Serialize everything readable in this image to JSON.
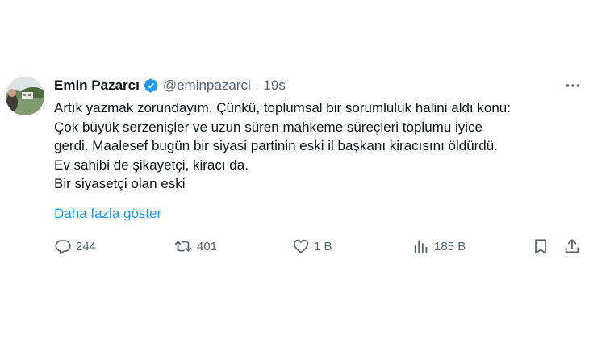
{
  "tweet": {
    "author": {
      "name": "Emin Pazarcı",
      "handle": "@eminpazarci",
      "separator": "·",
      "time": "19s",
      "verified": true
    },
    "lines": [
      "Artık yazmak zorundayım. Çünkü, toplumsal bir sorumluluk halini aldı konu:",
      "Çok büyük serzenişler ve uzun süren mahkeme süreçleri toplumu iyice",
      "gerdi. Maalesef bugün bir siyasi partinin eski il başkanı kiracısını öldürdü.",
      "Ev sahibi de şikayetçi, kiracı da.",
      "Bir siyasetçi olan eski"
    ],
    "show_more": "Daha fazla göster",
    "actions": {
      "replies": "244",
      "retweets": "401",
      "likes": "1 B",
      "views": "185 B"
    }
  },
  "icons": {
    "verified": "verified-badge-icon",
    "more": "more-options-icon",
    "reply": "reply-icon",
    "retweet": "retweet-icon",
    "like": "heart-icon",
    "views": "views-chart-icon",
    "bookmark": "bookmark-icon",
    "share": "share-icon"
  },
  "colors": {
    "text": "#0f1419",
    "secondary": "#536471",
    "link": "#1d9bf0",
    "verified": "#1d9bf0",
    "background": "#ffffff"
  }
}
